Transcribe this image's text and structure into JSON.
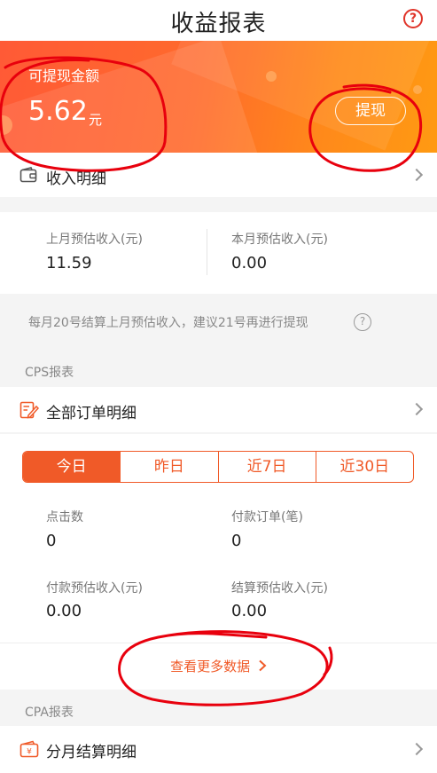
{
  "header": {
    "title": "收益报表",
    "help_icon": "?"
  },
  "balance": {
    "label": "可提现金额",
    "amount": "5.62",
    "unit": "元",
    "withdraw_label": "提现"
  },
  "income_detail": {
    "label": "收入明细"
  },
  "estimates": {
    "last_month": {
      "label": "上月预估收入(元)",
      "value": "11.59"
    },
    "this_month": {
      "label": "本月预估收入(元)",
      "value": "0.00"
    }
  },
  "notice": {
    "text": "每月20号结算上月预估收入，建议21号再进行提现",
    "help_icon": "?"
  },
  "cps": {
    "section_label": "CPS报表",
    "orders_label": "全部订单明细",
    "tabs": [
      "今日",
      "昨日",
      "近7日",
      "近30日"
    ],
    "active_tab": 0,
    "metrics": {
      "clicks": {
        "label": "点击数",
        "value": "0"
      },
      "paid_orders": {
        "label": "付款订单(笔)",
        "value": "0"
      },
      "paid_income": {
        "label": "付款预估收入(元)",
        "value": "0.00"
      },
      "settled_income": {
        "label": "结算预估收入(元)",
        "value": "0.00"
      }
    },
    "more_label": "查看更多数据"
  },
  "cpa": {
    "section_label": "CPA报表",
    "monthly_label": "分月结算明细"
  },
  "colors": {
    "accent": "#f05a28",
    "banner_start": "#ff5a36",
    "banner_end": "#ff9a12",
    "annotation": "#e8000d"
  }
}
